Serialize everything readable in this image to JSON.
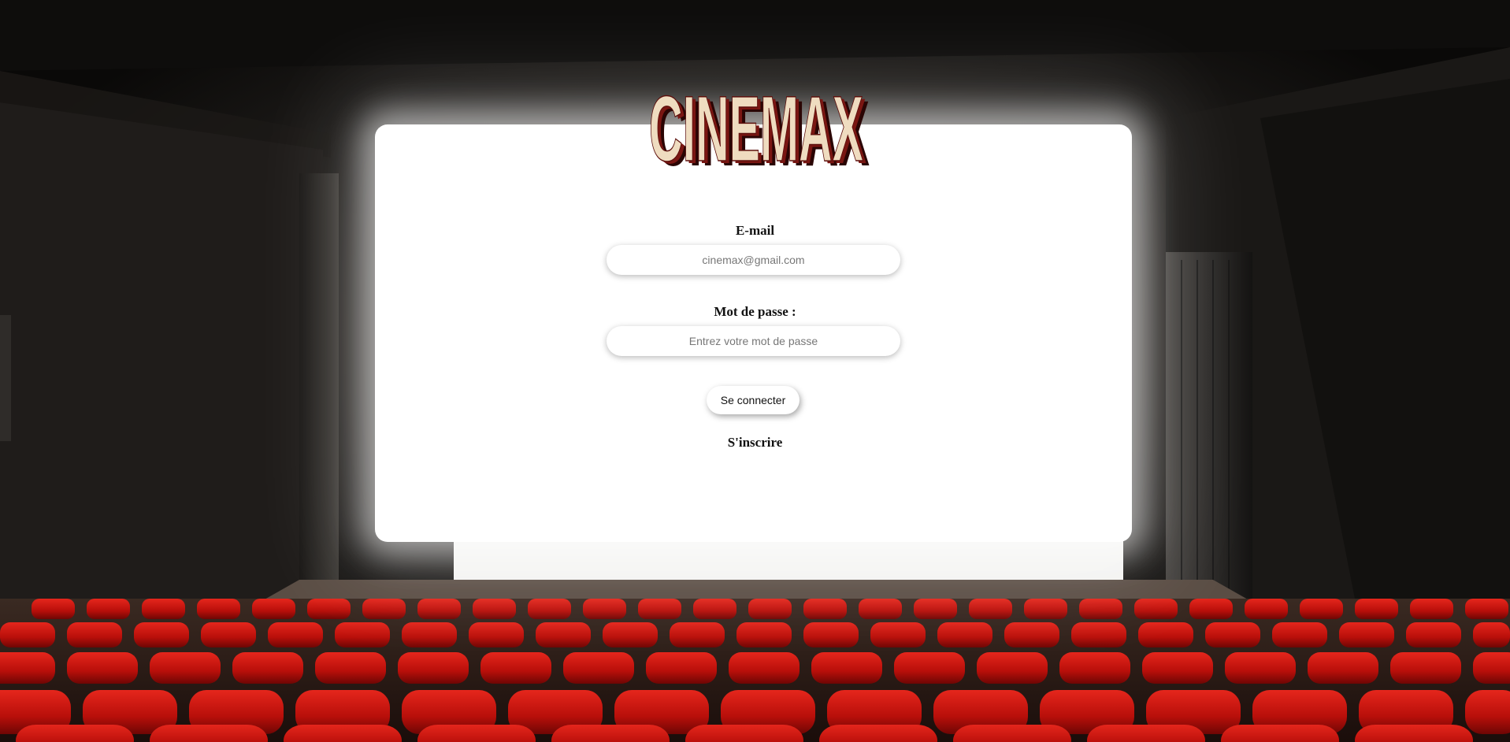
{
  "logo": {
    "text": "CINEMAX"
  },
  "form": {
    "email_label": "E-mail",
    "email_placeholder": "cinemax@gmail.com",
    "password_label": "Mot de passe :",
    "password_placeholder": "Entrez votre mot de passe",
    "login_button": "Se connecter",
    "signup_link": "S'inscrire"
  },
  "colors": {
    "seat_red": "#c8140e",
    "logo_cream": "#efdcc0",
    "logo_red": "#7a1612",
    "background_dark": "#0c0a09"
  }
}
